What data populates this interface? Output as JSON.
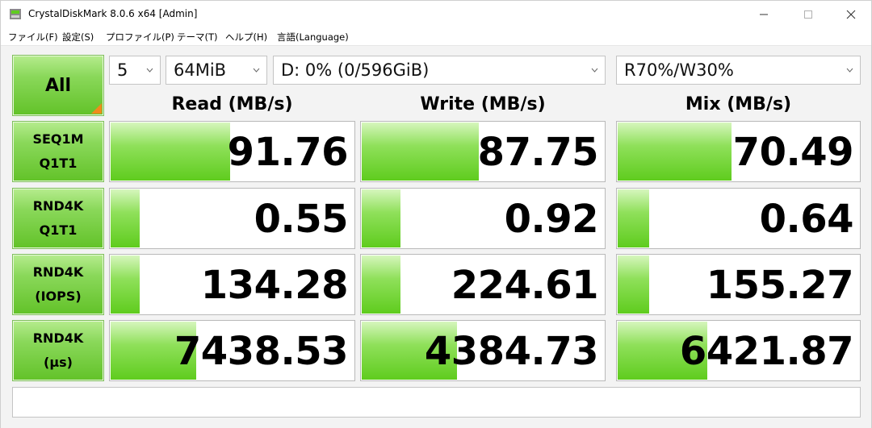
{
  "window": {
    "title": "CrystalDiskMark 8.0.6 x64 [Admin]"
  },
  "menu": [
    "ファイル(F)",
    "設定(S)",
    "プロファイル(P)",
    "テーマ(T)",
    "ヘルプ(H)",
    "言語(Language)"
  ],
  "controls": {
    "all_label": "All",
    "count": "5",
    "size": "64MiB",
    "drive": "D: 0% (0/596GiB)",
    "mix_ratio": "R70%/W30%"
  },
  "headers": {
    "read": "Read (MB/s)",
    "write": "Write (MB/s)",
    "mix": "Mix (MB/s)"
  },
  "rows": [
    {
      "line1": "SEQ1M",
      "line2": "Q1T1",
      "read": {
        "value": "91.76",
        "level": 0.49
      },
      "write": {
        "value": "87.75",
        "level": 0.48
      },
      "mix": {
        "value": "70.49",
        "level": 0.47
      }
    },
    {
      "line1": "RND4K",
      "line2": "Q1T1",
      "read": {
        "value": "0.55",
        "level": 0.12
      },
      "write": {
        "value": "0.92",
        "level": 0.16
      },
      "mix": {
        "value": "0.64",
        "level": 0.13
      }
    },
    {
      "line1": "RND4K",
      "line2": "(IOPS)",
      "read": {
        "value": "134.28",
        "level": 0.12
      },
      "write": {
        "value": "224.61",
        "level": 0.16
      },
      "mix": {
        "value": "155.27",
        "level": 0.13
      }
    },
    {
      "line1": "RND4K",
      "line2": "(µs)",
      "read": {
        "value": "7438.53",
        "level": 0.35
      },
      "write": {
        "value": "4384.73",
        "level": 0.39
      },
      "mix": {
        "value": "6421.87",
        "level": 0.37
      }
    }
  ],
  "comment": ""
}
